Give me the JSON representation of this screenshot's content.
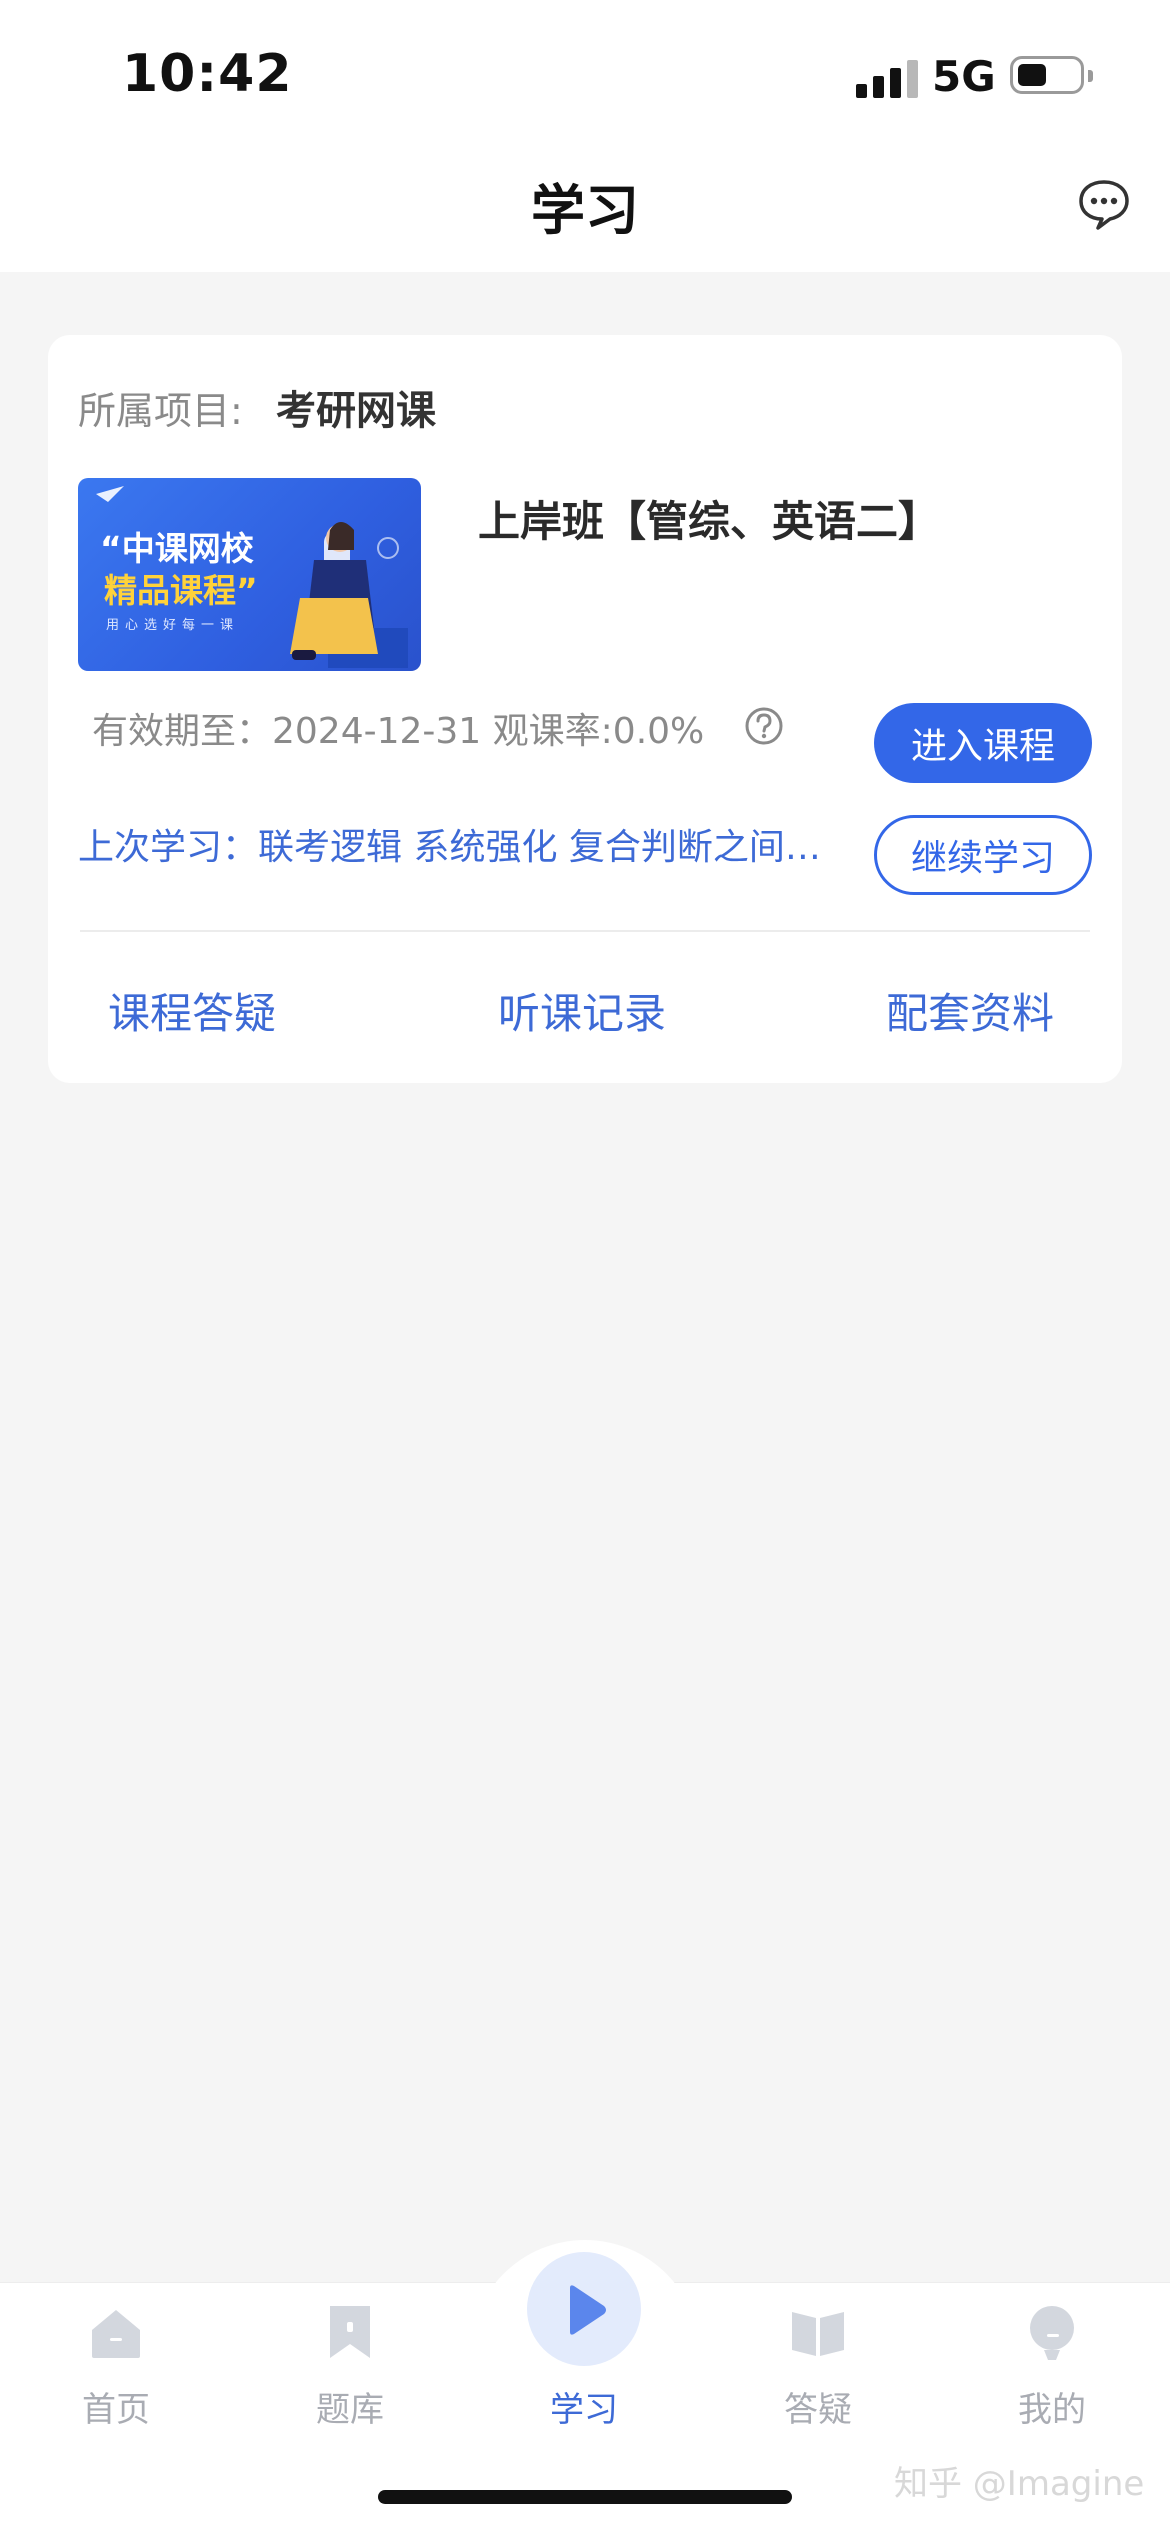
{
  "status_bar": {
    "time": "10:42",
    "network": "5G"
  },
  "header": {
    "title": "学习",
    "message_icon": "chat-bubble-icon"
  },
  "course_card": {
    "project_label": "所属项目:",
    "project_value": "考研网课",
    "cover": {
      "line1": "“中课网校",
      "line2": "精品课程”",
      "line3": "用心选好每一课"
    },
    "course_name": "上岸班【管综、英语二】",
    "validity_text": "有效期至：2024-12-31  观课率:0.0%",
    "enter_button": "进入课程",
    "last_study_label": "上次学习：",
    "last_study_value": "联考逻辑 系统强化 复合判断之间…",
    "continue_button": "继续学习",
    "actions": [
      "课程答疑",
      "听课记录",
      "配套资料"
    ]
  },
  "tabbar": {
    "items": [
      {
        "label": "首页",
        "icon": "home-icon"
      },
      {
        "label": "题库",
        "icon": "bookmark-icon"
      },
      {
        "label": "学习",
        "icon": "play-icon",
        "active": true
      },
      {
        "label": "答疑",
        "icon": "book-icon"
      },
      {
        "label": "我的",
        "icon": "profile-icon"
      }
    ]
  },
  "watermark": "知乎 @Imagine",
  "colors": {
    "accent": "#3367e8",
    "link": "#3d6ad6",
    "muted": "#8a8a8a",
    "background": "#f5f5f5"
  }
}
